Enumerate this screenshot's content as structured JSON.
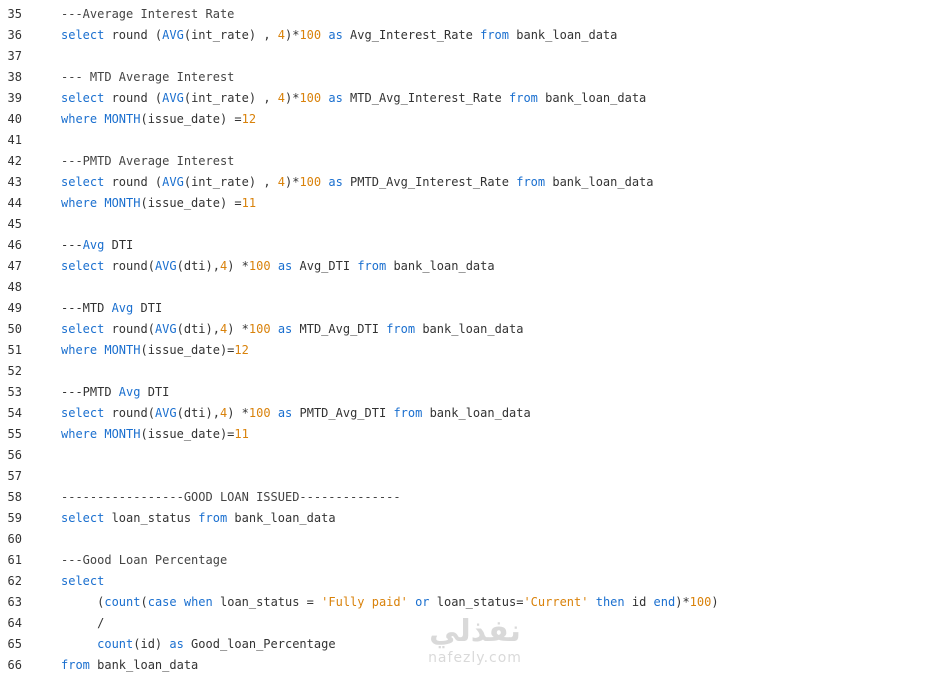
{
  "lines": [
    {
      "n": "35",
      "t": [
        [
          "---Average Interest Rate",
          "cm"
        ]
      ]
    },
    {
      "n": "36",
      "t": [
        [
          "select",
          "kw"
        ],
        [
          " round (",
          ""
        ],
        [
          "AVG",
          "kw"
        ],
        [
          "(int_rate) , ",
          ""
        ],
        [
          "4",
          "num"
        ],
        [
          ")*",
          ""
        ],
        [
          "100",
          "num"
        ],
        [
          " ",
          ""
        ],
        [
          "as",
          "kw"
        ],
        [
          " Avg_Interest_Rate ",
          ""
        ],
        [
          "from",
          "kw"
        ],
        [
          " bank_loan_data",
          ""
        ]
      ]
    },
    {
      "n": "37",
      "t": []
    },
    {
      "n": "38",
      "t": [
        [
          "--- MTD Average Interest",
          "cm"
        ]
      ]
    },
    {
      "n": "39",
      "t": [
        [
          "select",
          "kw"
        ],
        [
          " round (",
          ""
        ],
        [
          "AVG",
          "kw"
        ],
        [
          "(int_rate) , ",
          ""
        ],
        [
          "4",
          "num"
        ],
        [
          ")*",
          ""
        ],
        [
          "100",
          "num"
        ],
        [
          " ",
          ""
        ],
        [
          "as",
          "kw"
        ],
        [
          " MTD_Avg_Interest_Rate ",
          ""
        ],
        [
          "from",
          "kw"
        ],
        [
          " bank_loan_data",
          ""
        ]
      ]
    },
    {
      "n": "40",
      "t": [
        [
          "where",
          "kw"
        ],
        [
          " ",
          ""
        ],
        [
          "MONTH",
          "kw"
        ],
        [
          "(issue_date) =",
          ""
        ],
        [
          "12",
          "num"
        ]
      ]
    },
    {
      "n": "41",
      "t": []
    },
    {
      "n": "42",
      "t": [
        [
          "---PMTD Average Interest",
          "cm"
        ]
      ]
    },
    {
      "n": "43",
      "t": [
        [
          "select",
          "kw"
        ],
        [
          " round (",
          ""
        ],
        [
          "AVG",
          "kw"
        ],
        [
          "(int_rate) , ",
          ""
        ],
        [
          "4",
          "num"
        ],
        [
          ")*",
          ""
        ],
        [
          "100",
          "num"
        ],
        [
          " ",
          ""
        ],
        [
          "as",
          "kw"
        ],
        [
          " PMTD_Avg_Interest_Rate ",
          ""
        ],
        [
          "from",
          "kw"
        ],
        [
          " bank_loan_data",
          ""
        ]
      ]
    },
    {
      "n": "44",
      "t": [
        [
          "where",
          "kw"
        ],
        [
          " ",
          ""
        ],
        [
          "MONTH",
          "kw"
        ],
        [
          "(issue_date) =",
          ""
        ],
        [
          "11",
          "num"
        ]
      ]
    },
    {
      "n": "45",
      "t": []
    },
    {
      "n": "46",
      "t": [
        [
          "---",
          ""
        ],
        [
          "Avg",
          "kw"
        ],
        [
          " DTI",
          ""
        ]
      ]
    },
    {
      "n": "47",
      "t": [
        [
          "select",
          "kw"
        ],
        [
          " round(",
          ""
        ],
        [
          "AVG",
          "kw"
        ],
        [
          "(dti),",
          ""
        ],
        [
          "4",
          "num"
        ],
        [
          ") *",
          ""
        ],
        [
          "100",
          "num"
        ],
        [
          " ",
          ""
        ],
        [
          "as",
          "kw"
        ],
        [
          " Avg_DTI ",
          ""
        ],
        [
          "from",
          "kw"
        ],
        [
          " bank_loan_data",
          ""
        ]
      ]
    },
    {
      "n": "48",
      "t": []
    },
    {
      "n": "49",
      "t": [
        [
          "---MTD ",
          ""
        ],
        [
          "Avg",
          "kw"
        ],
        [
          " DTI",
          ""
        ]
      ]
    },
    {
      "n": "50",
      "t": [
        [
          "select",
          "kw"
        ],
        [
          " round(",
          ""
        ],
        [
          "AVG",
          "kw"
        ],
        [
          "(dti),",
          ""
        ],
        [
          "4",
          "num"
        ],
        [
          ") *",
          ""
        ],
        [
          "100",
          "num"
        ],
        [
          " ",
          ""
        ],
        [
          "as",
          "kw"
        ],
        [
          " MTD_Avg_DTI ",
          ""
        ],
        [
          "from",
          "kw"
        ],
        [
          " bank_loan_data",
          ""
        ]
      ]
    },
    {
      "n": "51",
      "t": [
        [
          "where",
          "kw"
        ],
        [
          " ",
          ""
        ],
        [
          "MONTH",
          "kw"
        ],
        [
          "(issue_date)=",
          ""
        ],
        [
          "12",
          "num"
        ]
      ]
    },
    {
      "n": "52",
      "t": []
    },
    {
      "n": "53",
      "t": [
        [
          "---PMTD ",
          ""
        ],
        [
          "Avg",
          "kw"
        ],
        [
          " DTI",
          ""
        ]
      ]
    },
    {
      "n": "54",
      "t": [
        [
          "select",
          "kw"
        ],
        [
          " round(",
          ""
        ],
        [
          "AVG",
          "kw"
        ],
        [
          "(dti),",
          ""
        ],
        [
          "4",
          "num"
        ],
        [
          ") *",
          ""
        ],
        [
          "100",
          "num"
        ],
        [
          " ",
          ""
        ],
        [
          "as",
          "kw"
        ],
        [
          " PMTD_Avg_DTI ",
          ""
        ],
        [
          "from",
          "kw"
        ],
        [
          " bank_loan_data",
          ""
        ]
      ]
    },
    {
      "n": "55",
      "t": [
        [
          "where",
          "kw"
        ],
        [
          " ",
          ""
        ],
        [
          "MONTH",
          "kw"
        ],
        [
          "(issue_date)=",
          ""
        ],
        [
          "11",
          "num"
        ]
      ]
    },
    {
      "n": "56",
      "t": []
    },
    {
      "n": "57",
      "t": []
    },
    {
      "n": "58",
      "t": [
        [
          "-----------------GOOD LOAN ISSUED--------------",
          "cm"
        ]
      ]
    },
    {
      "n": "59",
      "t": [
        [
          "select",
          "kw"
        ],
        [
          " loan_status ",
          ""
        ],
        [
          "from",
          "kw"
        ],
        [
          " bank_loan_data",
          ""
        ]
      ]
    },
    {
      "n": "60",
      "t": []
    },
    {
      "n": "61",
      "t": [
        [
          "---Good Loan Percentage",
          "cm"
        ]
      ]
    },
    {
      "n": "62",
      "t": [
        [
          "select",
          "kw"
        ]
      ]
    },
    {
      "n": "63",
      "t": [
        [
          "     (",
          ""
        ],
        [
          "count",
          "kw"
        ],
        [
          "(",
          ""
        ],
        [
          "case",
          "kw"
        ],
        [
          " ",
          ""
        ],
        [
          "when",
          "kw"
        ],
        [
          " loan_status = ",
          ""
        ],
        [
          "'Fully paid'",
          "str"
        ],
        [
          " ",
          ""
        ],
        [
          "or",
          "kw"
        ],
        [
          " loan_status=",
          ""
        ],
        [
          "'Current'",
          "str"
        ],
        [
          " ",
          ""
        ],
        [
          "then",
          "kw"
        ],
        [
          " id ",
          ""
        ],
        [
          "end",
          "kw"
        ],
        [
          ")*",
          ""
        ],
        [
          "100",
          "num"
        ],
        [
          ")",
          ""
        ]
      ]
    },
    {
      "n": "64",
      "t": [
        [
          "     /",
          ""
        ]
      ]
    },
    {
      "n": "65",
      "t": [
        [
          "     ",
          ""
        ],
        [
          "count",
          "kw"
        ],
        [
          "(id) ",
          ""
        ],
        [
          "as",
          "kw"
        ],
        [
          " Good_loan_Percentage",
          ""
        ]
      ]
    },
    {
      "n": "66",
      "t": [
        [
          "from",
          "kw"
        ],
        [
          " bank_loan_data",
          ""
        ]
      ]
    }
  ],
  "watermark": {
    "arabic": "نفذلي",
    "latin": "nafezly.com"
  }
}
